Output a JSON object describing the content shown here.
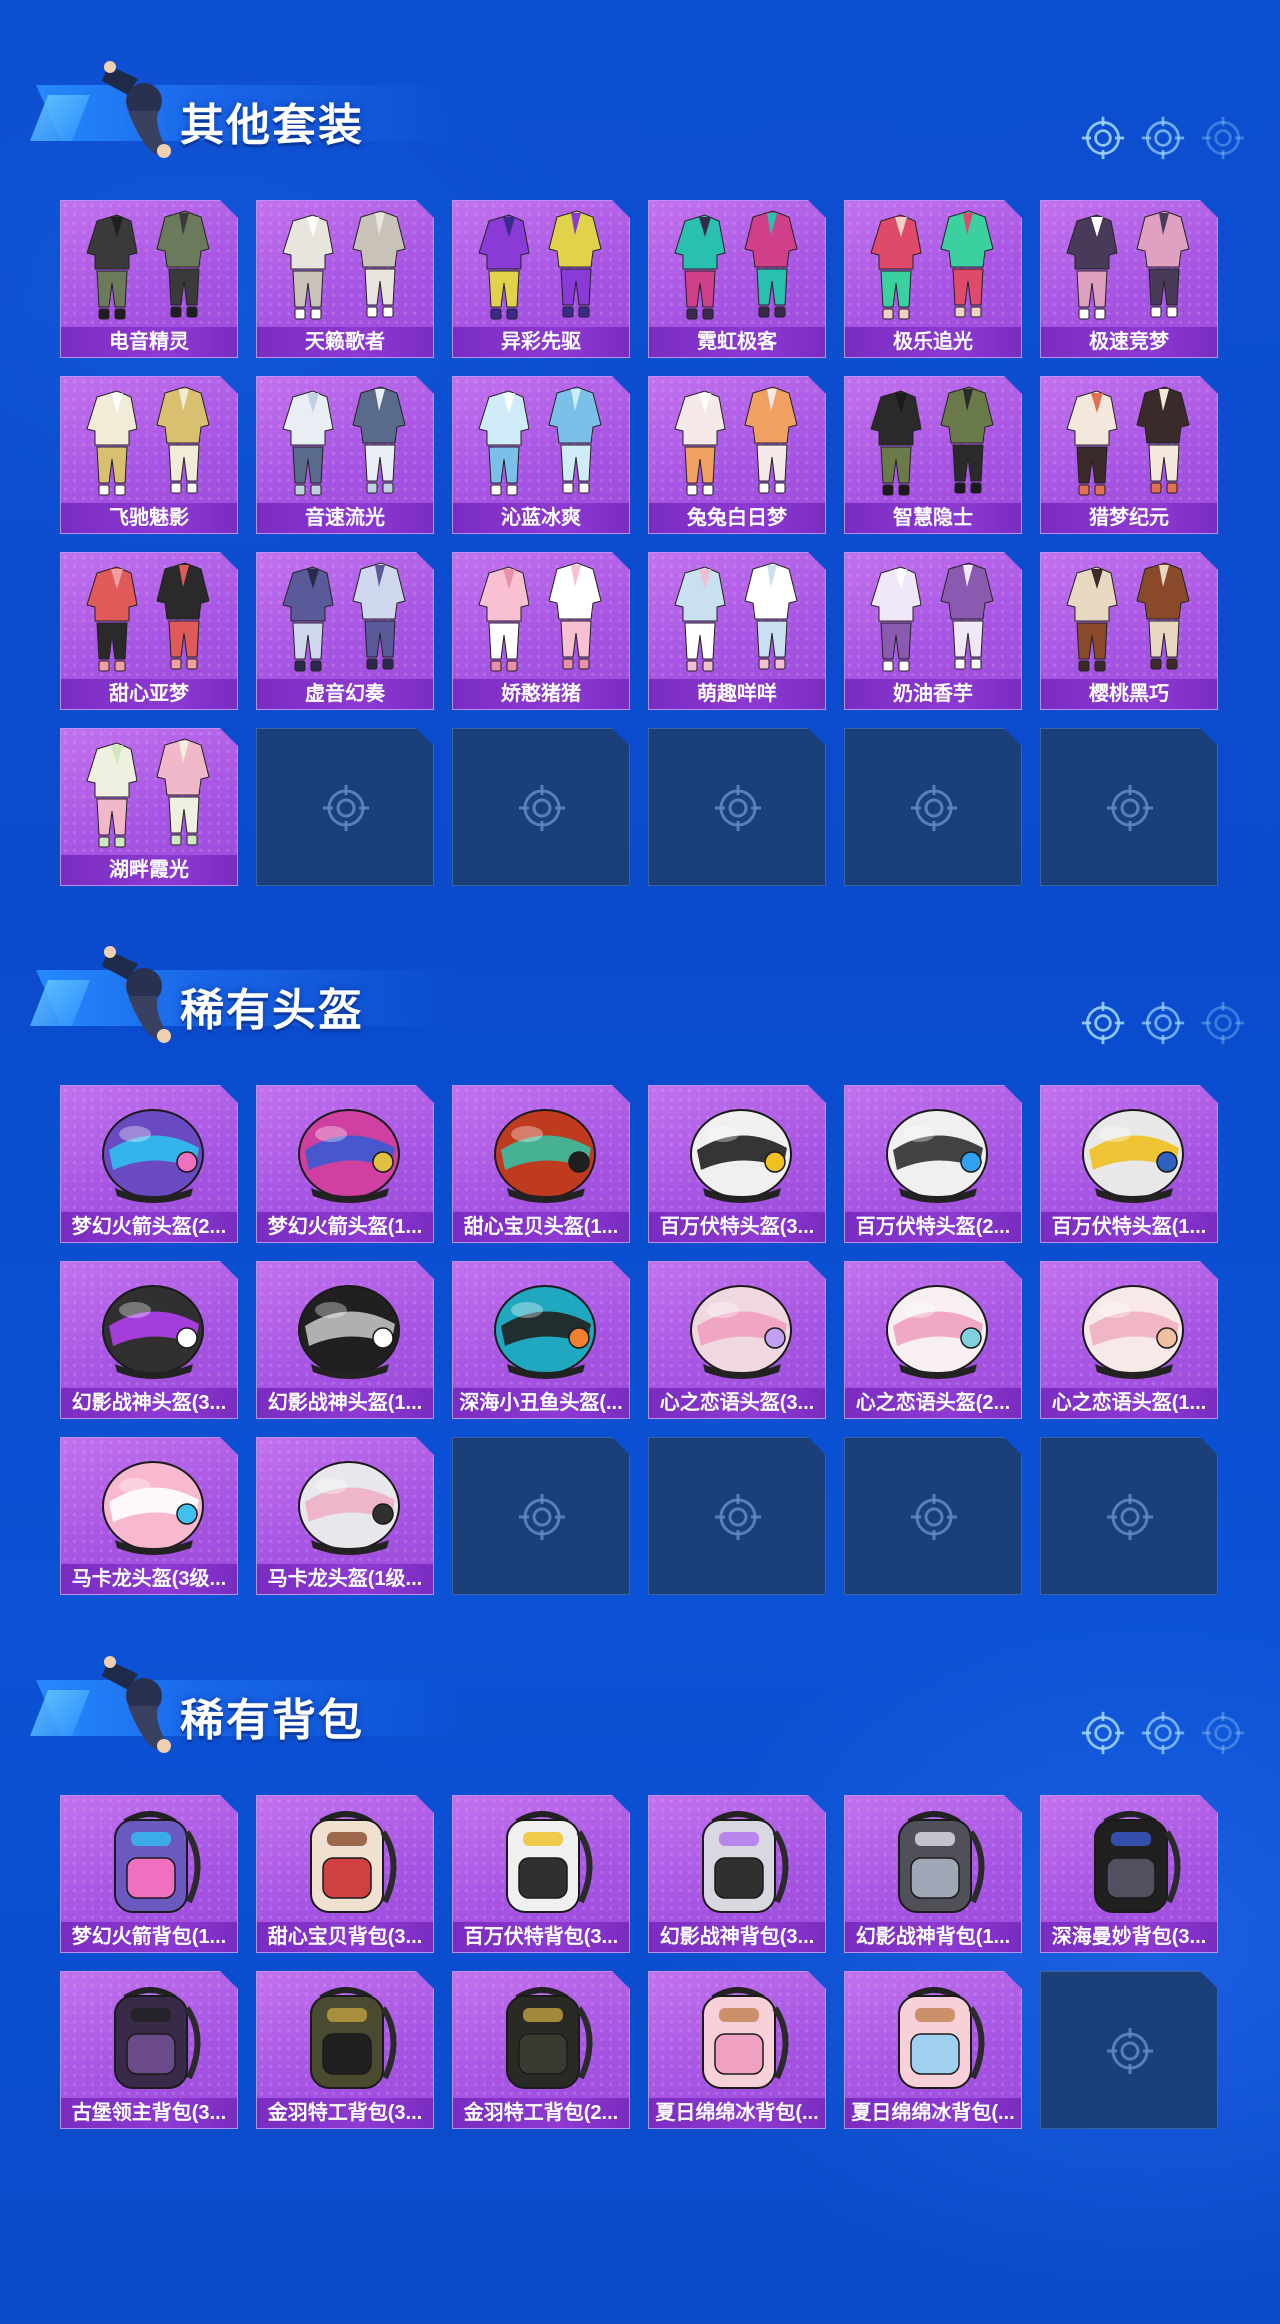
{
  "sections": [
    {
      "title": "其他套装",
      "items": [
        "电音精灵",
        "天籁歌者",
        "异彩先驱",
        "霓虹极客",
        "极乐追光",
        "极速竞梦",
        "飞驰魅影",
        "音速流光",
        "沁蓝冰爽",
        "兔兔白日梦",
        "智慧隐士",
        "猎梦纪元",
        "甜心亚梦",
        "虚音幻奏",
        "娇憨猪猪",
        "萌趣咩咩",
        "奶油香芋",
        "樱桃黑巧",
        "湖畔霞光"
      ],
      "empty_slots": 5
    },
    {
      "title": "稀有头盔",
      "items": [
        "梦幻火箭头盔(2...",
        "梦幻火箭头盔(1...",
        "甜心宝贝头盔(1...",
        "百万伏特头盔(3...",
        "百万伏特头盔(2...",
        "百万伏特头盔(1...",
        "幻影战神头盔(3...",
        "幻影战神头盔(1...",
        "深海小丑鱼头盔(...",
        "心之恋语头盔(3...",
        "心之恋语头盔(2...",
        "心之恋语头盔(1...",
        "马卡龙头盔(3级...",
        "马卡龙头盔(1级..."
      ],
      "empty_slots": 4
    },
    {
      "title": "稀有背包",
      "items": [
        "梦幻火箭背包(1...",
        "甜心宝贝背包(3...",
        "百万伏特背包(3...",
        "幻影战神背包(3...",
        "幻影战神背包(1...",
        "深海曼妙背包(3...",
        "古堡领主背包(3...",
        "金羽特工背包(3...",
        "金羽特工背包(2...",
        "夏日绵绵冰背包(...",
        "夏日绵绵冰背包(..."
      ],
      "empty_slots": 1
    }
  ],
  "icons": {
    "empty_slot": "crosshair-icon",
    "header_controls": [
      "crosshair-icon",
      "crosshair-icon",
      "crosshair-icon"
    ],
    "mascot": "mascot-figure"
  },
  "colors": {
    "background": "#0b4fd0",
    "tile_purple": "#a755e3",
    "tile_label": "#8e3ad2",
    "empty_tile": "#1b3f78"
  }
}
